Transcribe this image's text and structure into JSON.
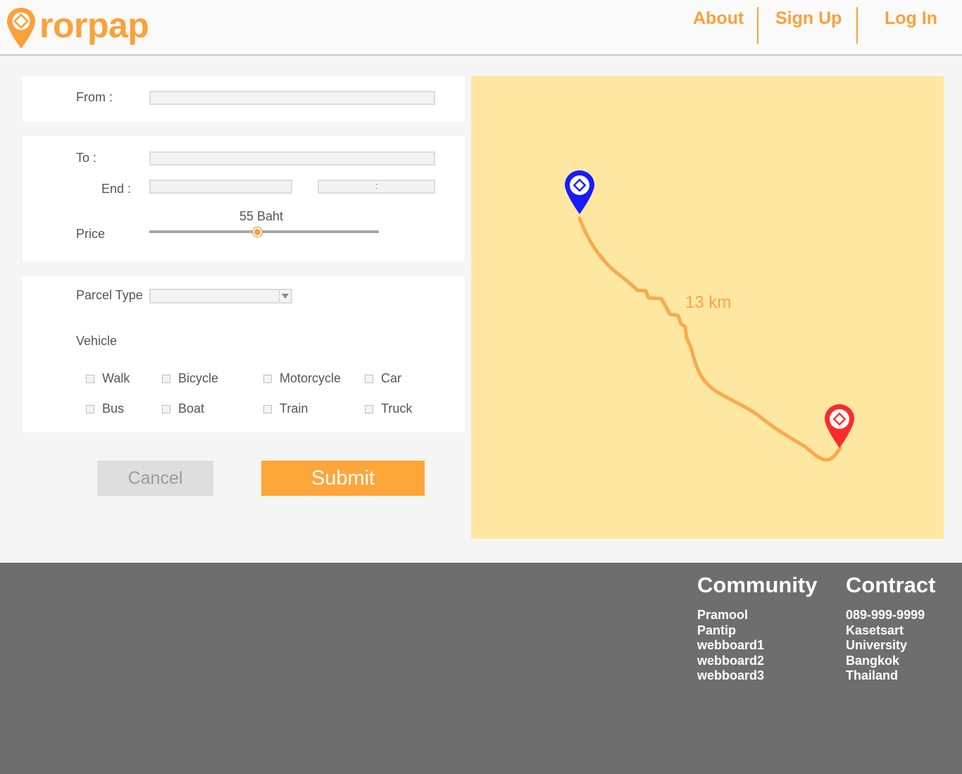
{
  "brand": {
    "name": "rorpap",
    "color": "#fca03a"
  },
  "nav": {
    "about": "About",
    "signup": "Sign Up",
    "login": "Log In"
  },
  "form": {
    "from_label": "From :",
    "from_value": "",
    "to_label": "To :",
    "to_value": "",
    "end_label": "End :",
    "end_date": "",
    "end_time_separator": ":",
    "price_label": "Price",
    "price_value": "55 Baht",
    "price_fraction": 0.47,
    "parcel_type_label": "Parcel Type",
    "parcel_type_selected": "",
    "vehicle_label": "Vehicle",
    "vehicles": [
      {
        "label": "Walk",
        "checked": false
      },
      {
        "label": "Bicycle",
        "checked": false
      },
      {
        "label": "Motorcycle",
        "checked": false
      },
      {
        "label": "Car",
        "checked": false
      },
      {
        "label": "Bus",
        "checked": false
      },
      {
        "label": "Boat",
        "checked": false
      },
      {
        "label": "Train",
        "checked": false
      },
      {
        "label": "Truck",
        "checked": false
      }
    ],
    "cancel_label": "Cancel",
    "submit_label": "Submit"
  },
  "map": {
    "distance": "13 km",
    "start_pin_color": "#1a1aff",
    "end_pin_color": "#ff2a2a",
    "route_color": "#f9a244",
    "background": "#fee7a1"
  },
  "footer": {
    "community_title": "Community",
    "community_items": [
      "Pramool",
      "Pantip",
      "webboard1",
      "webboard2",
      "webboard3"
    ],
    "contact_title": "Contract",
    "contact_items": [
      "089-999-9999",
      "Kasetsart",
      "University",
      "Bangkok",
      "Thailand"
    ]
  }
}
